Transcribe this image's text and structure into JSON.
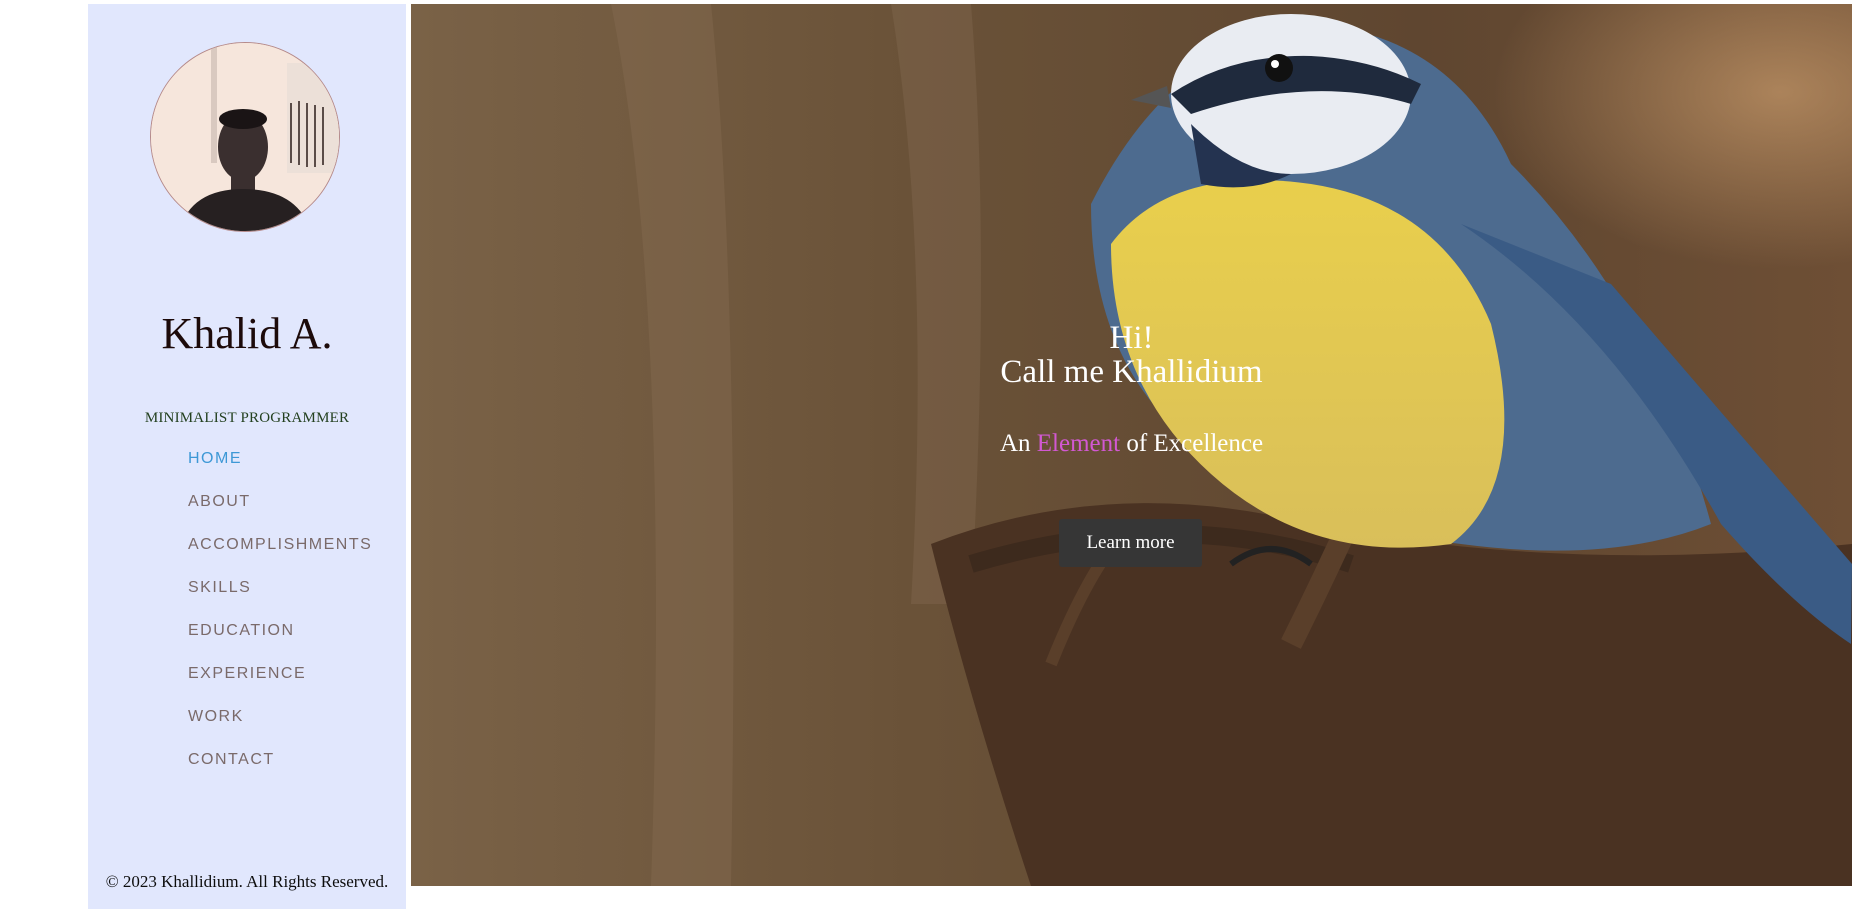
{
  "sidebar": {
    "name": "Khalid A.",
    "tagline": "MINIMALIST PROGRAMMER",
    "nav": [
      {
        "label": "HOME",
        "active": true
      },
      {
        "label": "ABOUT",
        "active": false
      },
      {
        "label": "ACCOMPLISHMENTS",
        "active": false
      },
      {
        "label": "SKILLS",
        "active": false
      },
      {
        "label": "EDUCATION",
        "active": false
      },
      {
        "label": "EXPERIENCE",
        "active": false
      },
      {
        "label": "WORK",
        "active": false
      },
      {
        "label": "CONTACT",
        "active": false
      }
    ],
    "copyright": "© 2023 Khallidium. All Rights Reserved."
  },
  "hero": {
    "greeting_line1": "Hi!",
    "greeting_line2": "Call me Khallidium",
    "motto_prefix": "An ",
    "motto_accent": "Element",
    "motto_suffix": " of Excellence",
    "cta_label": "Learn more"
  },
  "colors": {
    "sidebar_bg": "#e1e7fd",
    "nav_active": "#3d98d6",
    "nav_default": "#7a6a6a",
    "accent": "#d258d2",
    "button_bg": "#363636"
  }
}
